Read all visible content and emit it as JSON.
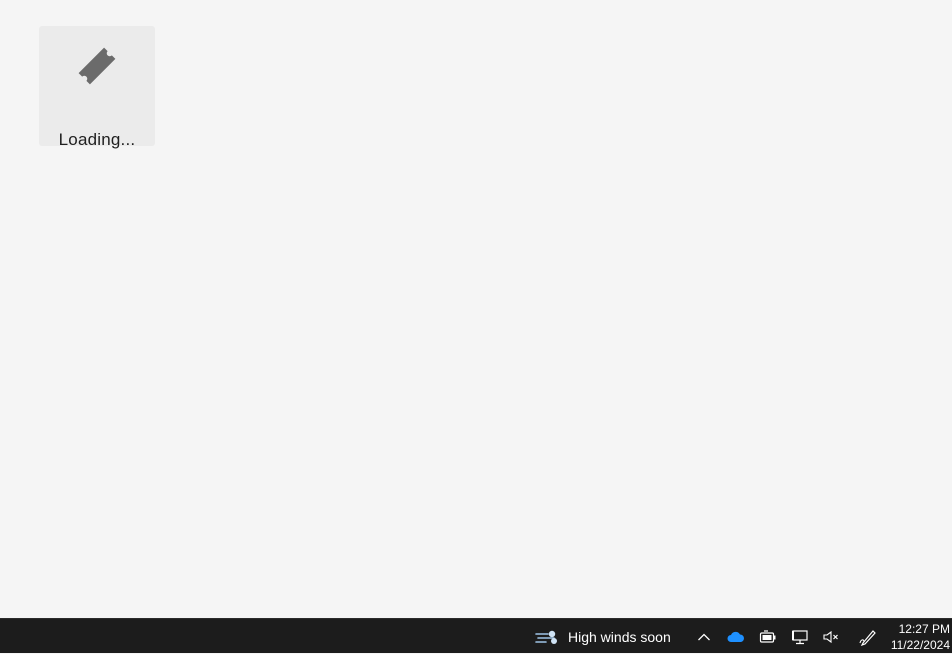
{
  "desktop": {
    "tile": {
      "icon": "ticket-icon",
      "label": "Loading..."
    }
  },
  "taskbar": {
    "weather": {
      "icon": "wind-icon",
      "text": "High winds soon"
    },
    "tray": {
      "chevron_icon": "chevron-up-icon",
      "onedrive_icon": "cloud-icon",
      "battery_icon": "battery-icon",
      "network_icon": "network-icon",
      "volume_icon": "volume-muted-icon",
      "pen_icon": "pen-icon"
    },
    "clock": {
      "time": "12:27 PM",
      "date": "11/22/2024"
    }
  },
  "colors": {
    "desktop_bg": "#f5f5f5",
    "tile_bg": "#ebebeb",
    "icon_gray": "#6b6b6b",
    "taskbar_bg": "#1c1c1c",
    "onedrive_blue": "#1e90ff"
  }
}
